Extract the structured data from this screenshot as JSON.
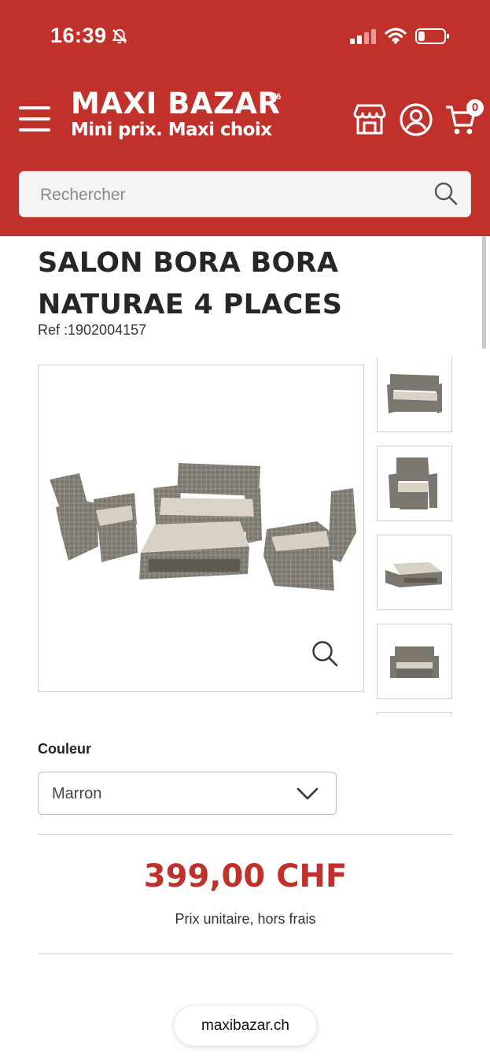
{
  "status_bar": {
    "time": "16:39",
    "bell_icon": "bell-slash-icon",
    "signal_icon": "cellular-signal-icon",
    "wifi_icon": "wifi-icon",
    "battery_icon": "battery-icon",
    "battery_level": 0.25
  },
  "header": {
    "menu_icon": "hamburger-menu-icon",
    "logo": {
      "main": "MAXI BAZAR",
      "superscript": "M6",
      "tagline": "Mini prix. Maxi choix"
    },
    "store_icon": "store-icon",
    "account_icon": "user-icon",
    "cart_icon": "cart-icon",
    "cart_count": "0",
    "background_color": "#c1312c"
  },
  "search": {
    "placeholder": "Rechercher",
    "value": "",
    "icon": "search-icon"
  },
  "product": {
    "title": "SALON BORA BORA NATURAE 4 PLACES",
    "ref_label": "Ref :",
    "ref_value": "1902004157",
    "zoom_icon": "zoom-icon",
    "thumbnails": [
      {
        "name": "sofa"
      },
      {
        "name": "armchair"
      },
      {
        "name": "coffee-table"
      },
      {
        "name": "sofa-front"
      }
    ],
    "color": {
      "label": "Couleur",
      "selected": "Marron",
      "chevron_icon": "chevron-down-icon"
    },
    "price": "399,00 CHF",
    "price_note": "Prix unitaire, hors frais",
    "accent_color": "#c1312c"
  },
  "browser": {
    "url": "maxibazar.ch"
  }
}
